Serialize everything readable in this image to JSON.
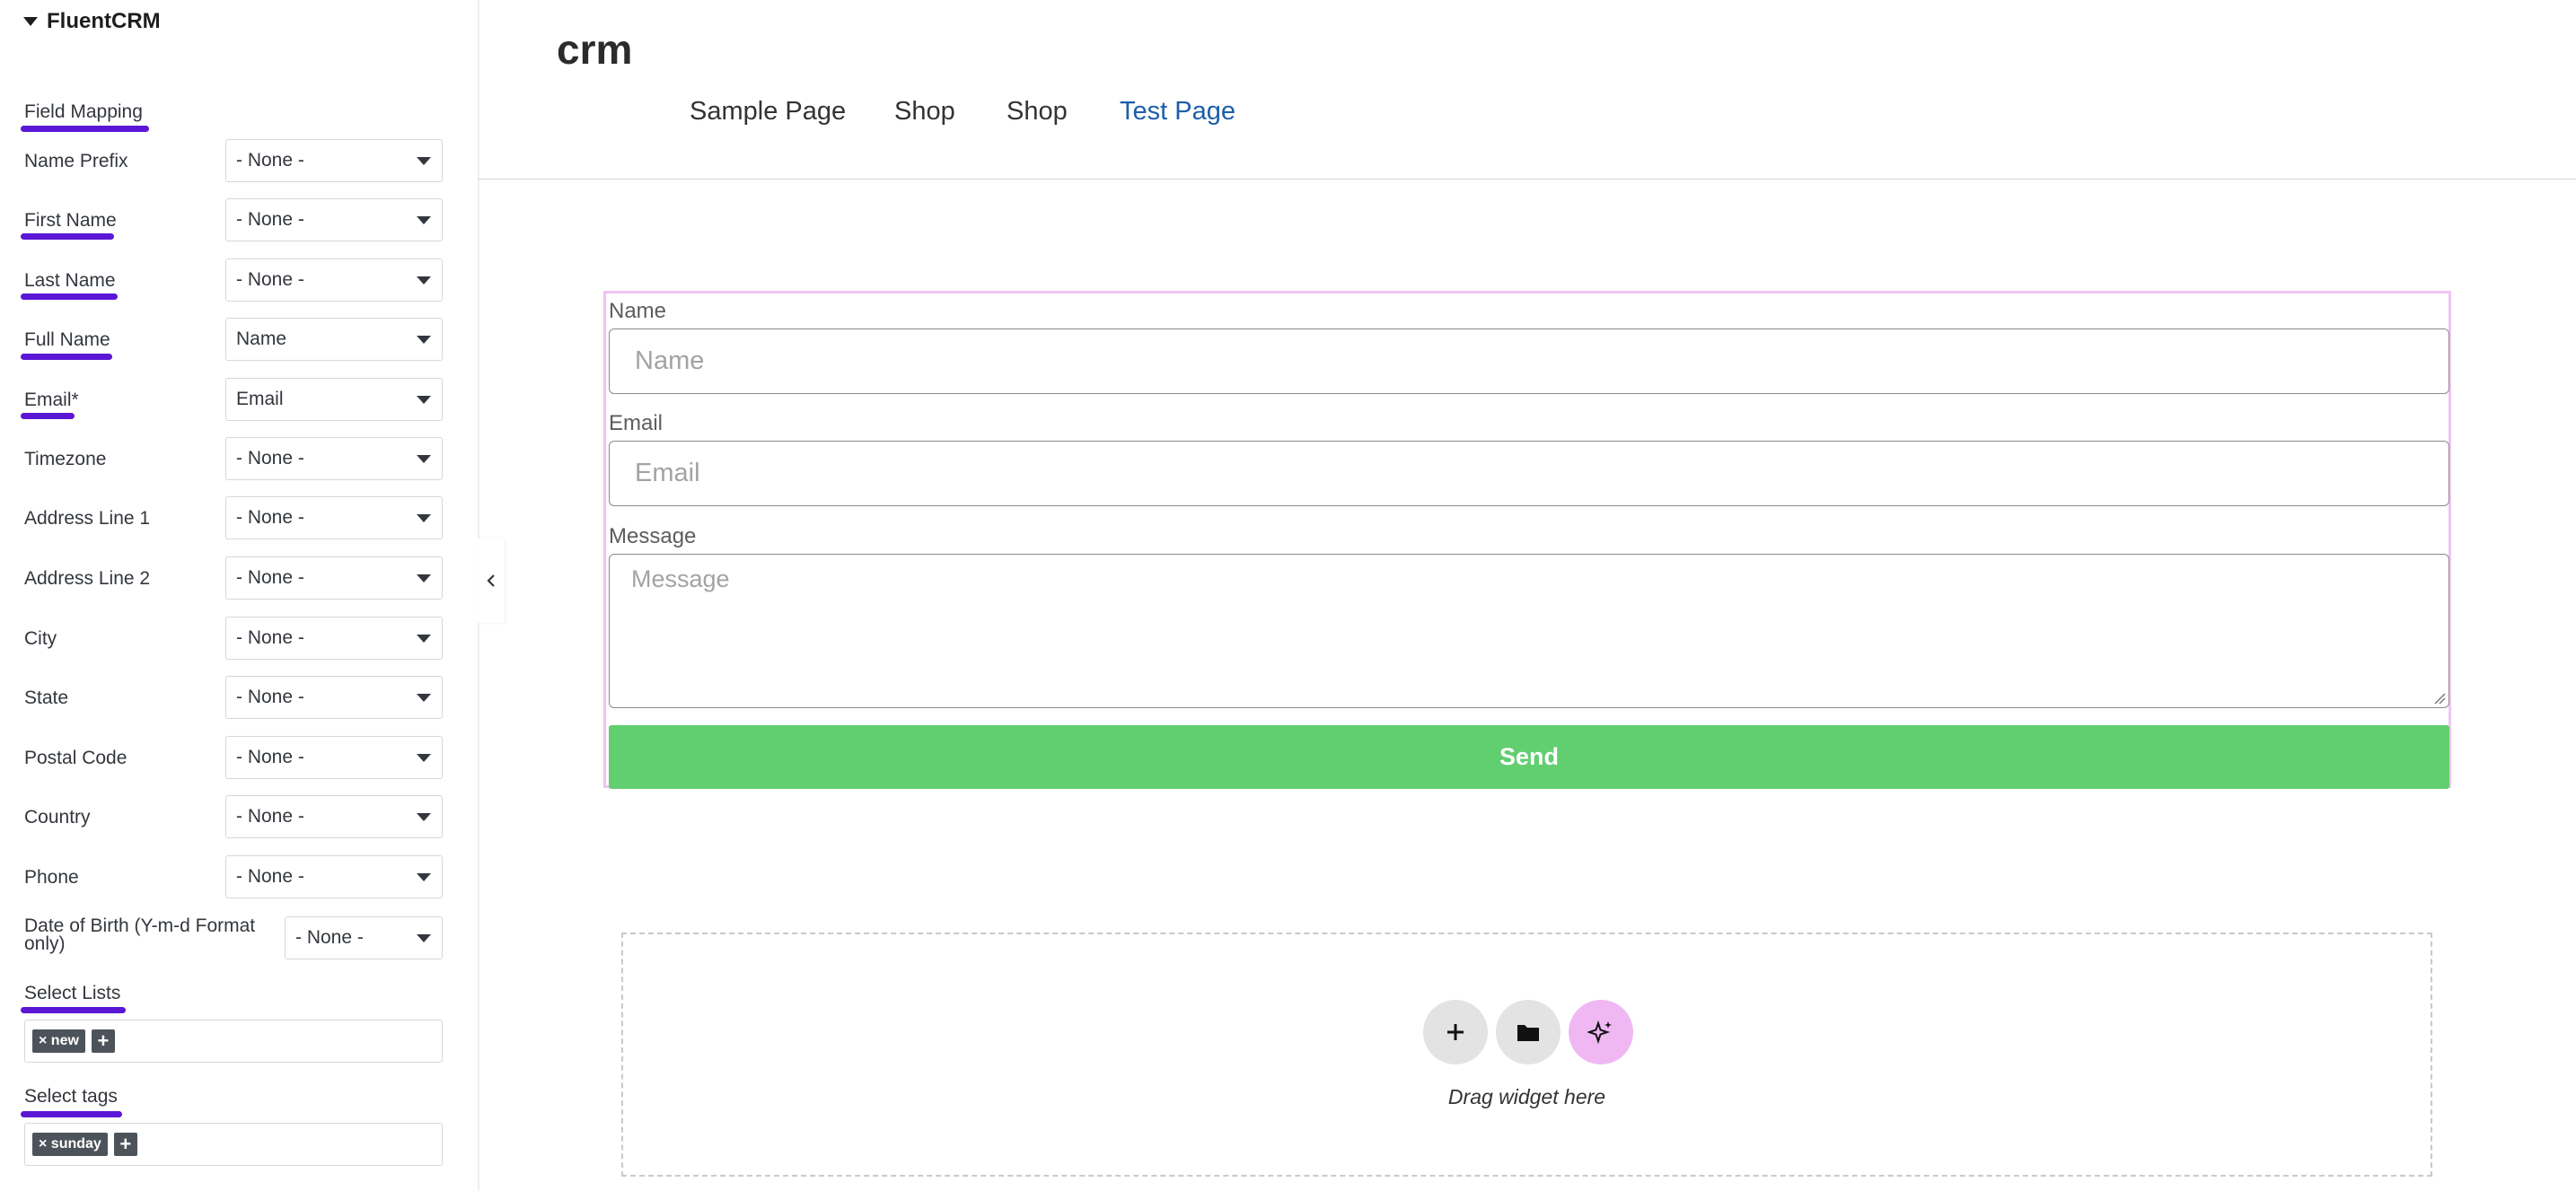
{
  "panel": {
    "section_title": "FluentCRM",
    "field_mapping_title": "Field Mapping",
    "fields": [
      {
        "label": "Name Prefix",
        "value": "- None -"
      },
      {
        "label": "First Name",
        "value": "- None -"
      },
      {
        "label": "Last Name",
        "value": "- None -"
      },
      {
        "label": "Full Name",
        "value": "Name"
      },
      {
        "label": "Email*",
        "value": "Email"
      },
      {
        "label": "Timezone",
        "value": "- None -"
      },
      {
        "label": "Address Line 1",
        "value": "- None -"
      },
      {
        "label": "Address Line 2",
        "value": "- None -"
      },
      {
        "label": "City",
        "value": "- None -"
      },
      {
        "label": "State",
        "value": "- None -"
      },
      {
        "label": "Postal Code",
        "value": "- None -"
      },
      {
        "label": "Country",
        "value": "- None -"
      },
      {
        "label": "Phone",
        "value": "- None -"
      },
      {
        "label_line1": "Date of Birth (Y-m-d Format",
        "label_line2": "only)",
        "value": "- None -"
      }
    ],
    "select_lists": {
      "title": "Select Lists",
      "chip": "× new",
      "add": "+"
    },
    "select_tags": {
      "title": "Select tags",
      "chip": "× sunday",
      "add": "+"
    },
    "highlight_color": "#5b17d6"
  },
  "site": {
    "title": "crm",
    "nav": [
      "Sample Page",
      "Shop",
      "Shop",
      "Test Page"
    ],
    "active_nav_color": "#1d5ea8"
  },
  "form": {
    "name_label": "Name",
    "name_placeholder": "Name",
    "email_label": "Email",
    "email_placeholder": "Email",
    "message_label": "Message",
    "message_placeholder": "Message",
    "submit_label": "Send",
    "submit_color": "#61ce70"
  },
  "drop_zone": {
    "text": "Drag widget here",
    "buttons": [
      "plus-icon",
      "folder-icon",
      "ai-sparkle-icon"
    ]
  }
}
